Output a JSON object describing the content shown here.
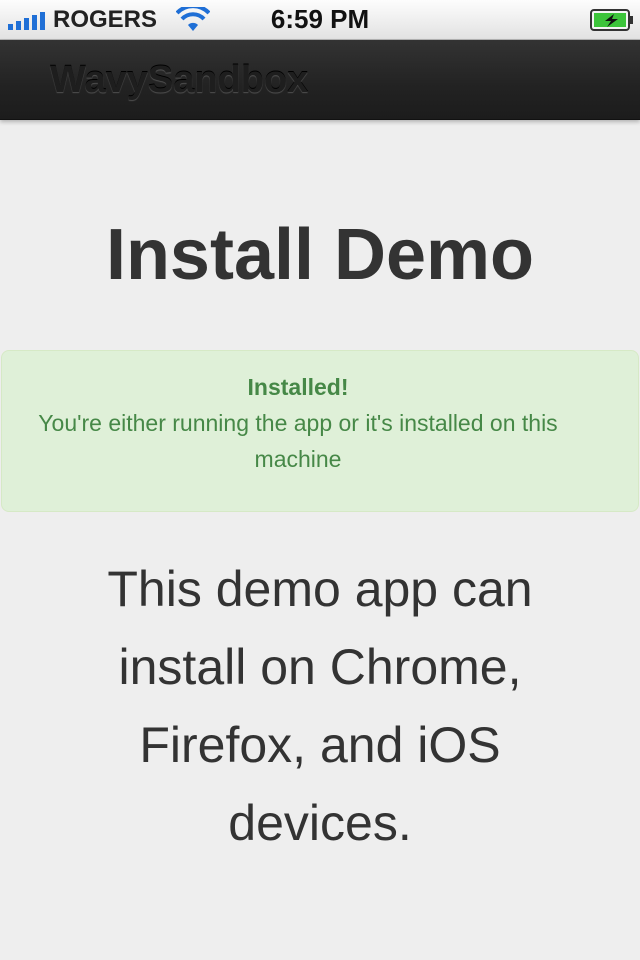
{
  "status_bar": {
    "carrier": "ROGERS",
    "time": "6:59 PM",
    "signal_bars": 5,
    "battery_level": 1.0,
    "icons": [
      "signal-icon",
      "wifi-icon",
      "battery-charging-icon"
    ]
  },
  "navbar": {
    "brand": "WavySandbox"
  },
  "main": {
    "title": "Install Demo",
    "alert": {
      "title": "Installed!",
      "message": "You're either running the app or it's installed on this machine"
    },
    "description": "This demo app can install on Chrome, Firefox, and iOS devices."
  },
  "colors": {
    "navbar_bg": "#222222",
    "alert_bg": "#dff0d8",
    "alert_text": "#468847",
    "body_bg": "#eeeeee",
    "text": "#333333"
  }
}
